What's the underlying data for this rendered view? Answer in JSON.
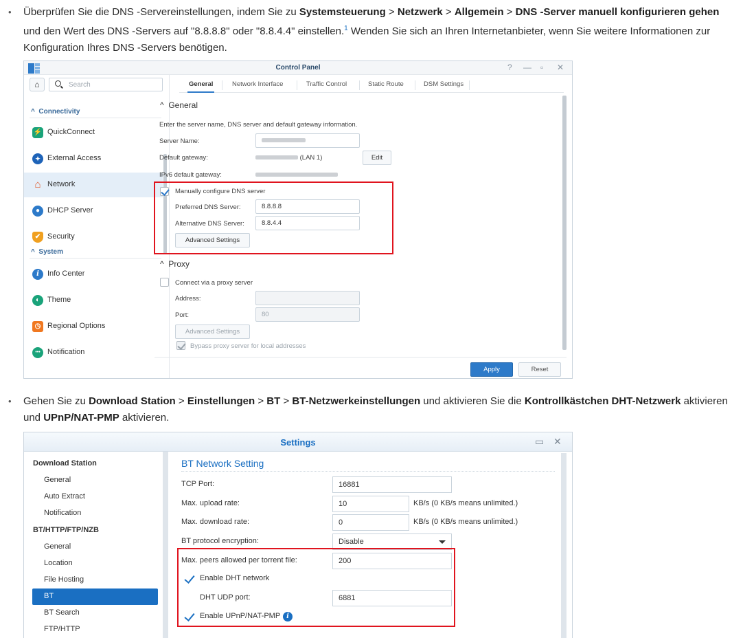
{
  "article": {
    "bullet1": {
      "s1": "Überprüfen Sie die DNS -Servereinstellungen, indem Sie zu ",
      "b1": "Systemsteuerung",
      "s2": " > ",
      "b2": "Netzwerk",
      "s3": " > ",
      "b3": "Allgemein",
      "s4": " > ",
      "b4": "DNS -Server manuell konfigurieren gehen",
      "s5": " und den Wert des DNS -Servers auf \"8.8.8.8\" oder \"8.8.4.4\" einstellen.",
      "sup": "1",
      "s6": " Wenden Sie sich an Ihren Internetanbieter, wenn Sie weitere Informationen zur Konfiguration Ihres DNS -Servers benötigen."
    },
    "bullet2": {
      "s1": "Gehen Sie zu ",
      "b1": "Download Station",
      "s2": " > ",
      "b2": "Einstellungen",
      "s3": " > ",
      "b3": "BT",
      "s4": " > ",
      "b4": "BT-Netzwerkeinstellungen",
      "s5": " und aktivieren Sie die ",
      "b5": "Kontrollkästchen DHT-Netzwerk",
      "s6": " aktivieren und ",
      "b6": "UPnP/NAT-PMP",
      "s7": " aktivieren."
    }
  },
  "control_panel": {
    "title": "Control Panel",
    "window_controls": {
      "help": "?",
      "minimize": "—",
      "maximize": "▫",
      "close": "✕"
    },
    "home_icon": "⌂",
    "search_placeholder": "Search",
    "sections": {
      "connectivity": "Connectivity",
      "system": "System"
    },
    "sidebar": [
      {
        "label": "QuickConnect",
        "icon": "quickconnect-icon",
        "color": "#1aa37a",
        "glyph": "⚡"
      },
      {
        "label": "External Access",
        "icon": "globe-icon",
        "color": "#1e63b8",
        "glyph": "🌐"
      },
      {
        "label": "Network",
        "icon": "home-network-icon",
        "color": "#e05a2b",
        "glyph": "⌂"
      },
      {
        "label": "DHCP Server",
        "icon": "dhcp-icon",
        "color": "#2d7ac9",
        "glyph": "●"
      },
      {
        "label": "Security",
        "icon": "shield-icon",
        "color": "#f0a020",
        "glyph": "✔"
      },
      {
        "label": "Info Center",
        "icon": "info-icon",
        "color": "#2d7ac9",
        "glyph": "i"
      },
      {
        "label": "Theme",
        "icon": "palette-icon",
        "color": "#1aa37a",
        "glyph": "◐"
      },
      {
        "label": "Regional Options",
        "icon": "regional-clock-icon",
        "color": "#f07820",
        "glyph": "◷"
      },
      {
        "label": "Notification",
        "icon": "chat-bubble-icon",
        "color": "#1aa37a",
        "glyph": "•••"
      }
    ],
    "tabs": [
      "General",
      "Network Interface",
      "Traffic Control",
      "Static Route",
      "DSM Settings"
    ],
    "general": {
      "heading": "General",
      "description": "Enter the server name, DNS server and default gateway information.",
      "server_name_label": "Server Name:",
      "default_gateway_label": "Default gateway:",
      "gateway_suffix": "(LAN 1)",
      "edit_button": "Edit",
      "ipv6_gateway_label": "IPv6 default gateway:",
      "manual_dns_label": "Manually configure DNS server",
      "manual_dns_checked": true,
      "preferred_dns_label": "Preferred DNS Server:",
      "preferred_dns_value": "8.8.8.8",
      "alternative_dns_label": "Alternative DNS Server:",
      "alternative_dns_value": "8.8.4.4",
      "advanced_button": "Advanced Settings"
    },
    "proxy": {
      "heading": "Proxy",
      "connect_label": "Connect via a proxy server",
      "connect_checked": false,
      "address_label": "Address:",
      "port_label": "Port:",
      "port_value": "80",
      "advanced_button": "Advanced Settings",
      "bypass_label": "Bypass proxy server for local addresses",
      "bypass_checked": true
    },
    "apply_button": "Apply",
    "reset_button": "Reset"
  },
  "settings": {
    "title": "Settings",
    "window_controls": {
      "maximize": "▭",
      "close": "✕"
    },
    "groups": [
      {
        "heading": "Download Station",
        "items": [
          "General",
          "Auto Extract",
          "Notification"
        ]
      },
      {
        "heading": "BT/HTTP/FTP/NZB",
        "items": [
          "General",
          "Location",
          "File Hosting",
          "BT",
          "BT Search",
          "FTP/HTTP"
        ]
      }
    ],
    "active_item": "BT",
    "bt": {
      "heading": "BT Network Setting",
      "tcp_port_label": "TCP Port:",
      "tcp_port_value": "16881",
      "upload_label": "Max. upload rate:",
      "upload_value": "10",
      "upload_note": "KB/s (0 KB/s means unlimited.)",
      "download_label": "Max. download rate:",
      "download_value": "0",
      "download_note": "KB/s (0 KB/s means unlimited.)",
      "encryption_label": "BT protocol encryption:",
      "encryption_value": "Disable",
      "peers_label": "Max. peers allowed per torrent file:",
      "peers_value": "200",
      "dht_label": "Enable DHT network",
      "dht_checked": true,
      "dht_port_label": "DHT UDP port:",
      "dht_port_value": "6881",
      "upnp_label": "Enable UPnP/NAT-PMP",
      "upnp_checked": true,
      "info_glyph": "i"
    }
  },
  "colors": {
    "accent": "#1a6fc2",
    "highlight": "#e0141e",
    "apply": "#2d7ac9"
  }
}
